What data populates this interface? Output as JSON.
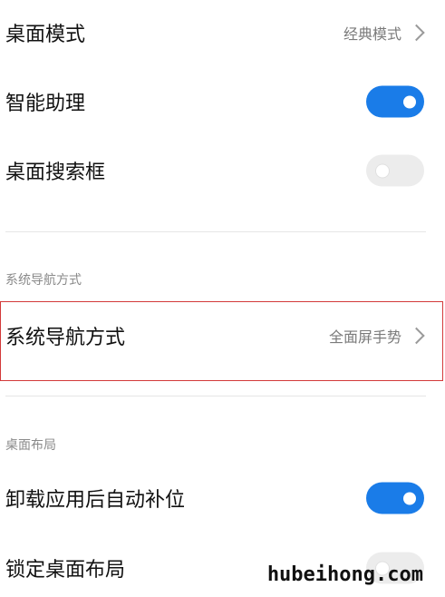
{
  "settings": {
    "desktop_mode": {
      "label": "桌面模式",
      "value": "经典模式"
    },
    "smart_assistant": {
      "label": "智能助理",
      "enabled": true
    },
    "desktop_search_box": {
      "label": "桌面搜索框",
      "enabled": false
    },
    "nav_section": {
      "header": "系统导航方式"
    },
    "system_navigation": {
      "label": "系统导航方式",
      "value": "全面屏手势"
    },
    "layout_section": {
      "header": "桌面布局"
    },
    "auto_fill_after_uninstall": {
      "label": "卸载应用后自动补位",
      "enabled": true
    },
    "lock_desktop_layout": {
      "label": "锁定桌面布局",
      "enabled": false
    }
  },
  "watermark": "hubeihong.com",
  "colors": {
    "toggle_on": "#1a7ce8",
    "toggle_off": "#ececec",
    "highlight": "#d33a3a"
  }
}
